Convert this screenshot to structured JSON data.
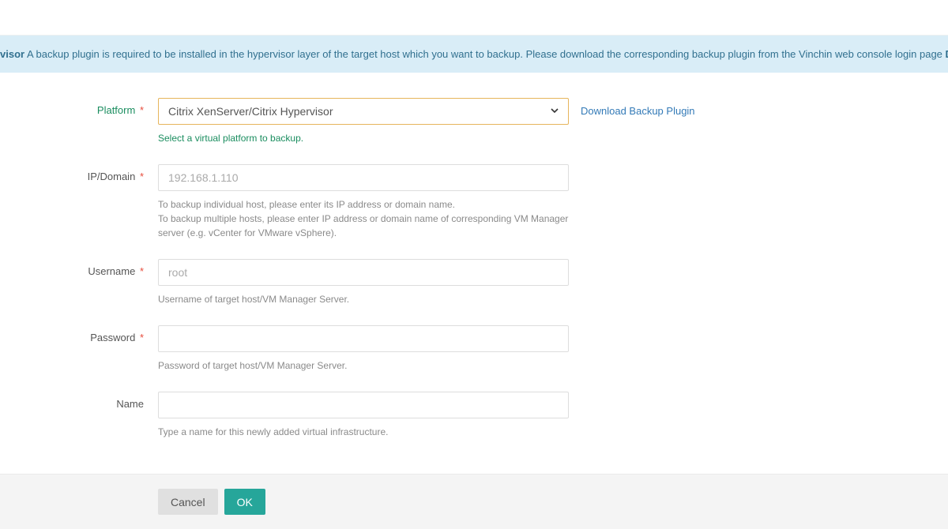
{
  "alert": {
    "prefix_bold": "visor",
    "text_1": " A backup plugin is required to be installed in the hypervisor layer of the target host which you want to backup. Please download the corresponding backup plugin from the Vinchin web console login page ",
    "suffix_bold": "Do"
  },
  "form": {
    "platform": {
      "label": "Platform",
      "value": "Citrix XenServer/Citrix Hypervisor",
      "help": "Select a virtual platform to backup.",
      "download_link": "Download Backup Plugin"
    },
    "ip": {
      "label": "IP/Domain",
      "placeholder": "192.168.1.110",
      "help1": "To backup individual host, please enter its IP address or domain name.",
      "help2": "To backup multiple hosts, please enter IP address or domain name of corresponding VM Manager server (e.g. vCenter for VMware vSphere)."
    },
    "username": {
      "label": "Username",
      "placeholder": "root",
      "help": "Username of target host/VM Manager Server."
    },
    "password": {
      "label": "Password",
      "placeholder": "",
      "help": "Password of target host/VM Manager Server."
    },
    "name": {
      "label": "Name",
      "placeholder": "",
      "help": "Type a name for this newly added virtual infrastructure."
    }
  },
  "footer": {
    "cancel": "Cancel",
    "ok": "OK"
  }
}
